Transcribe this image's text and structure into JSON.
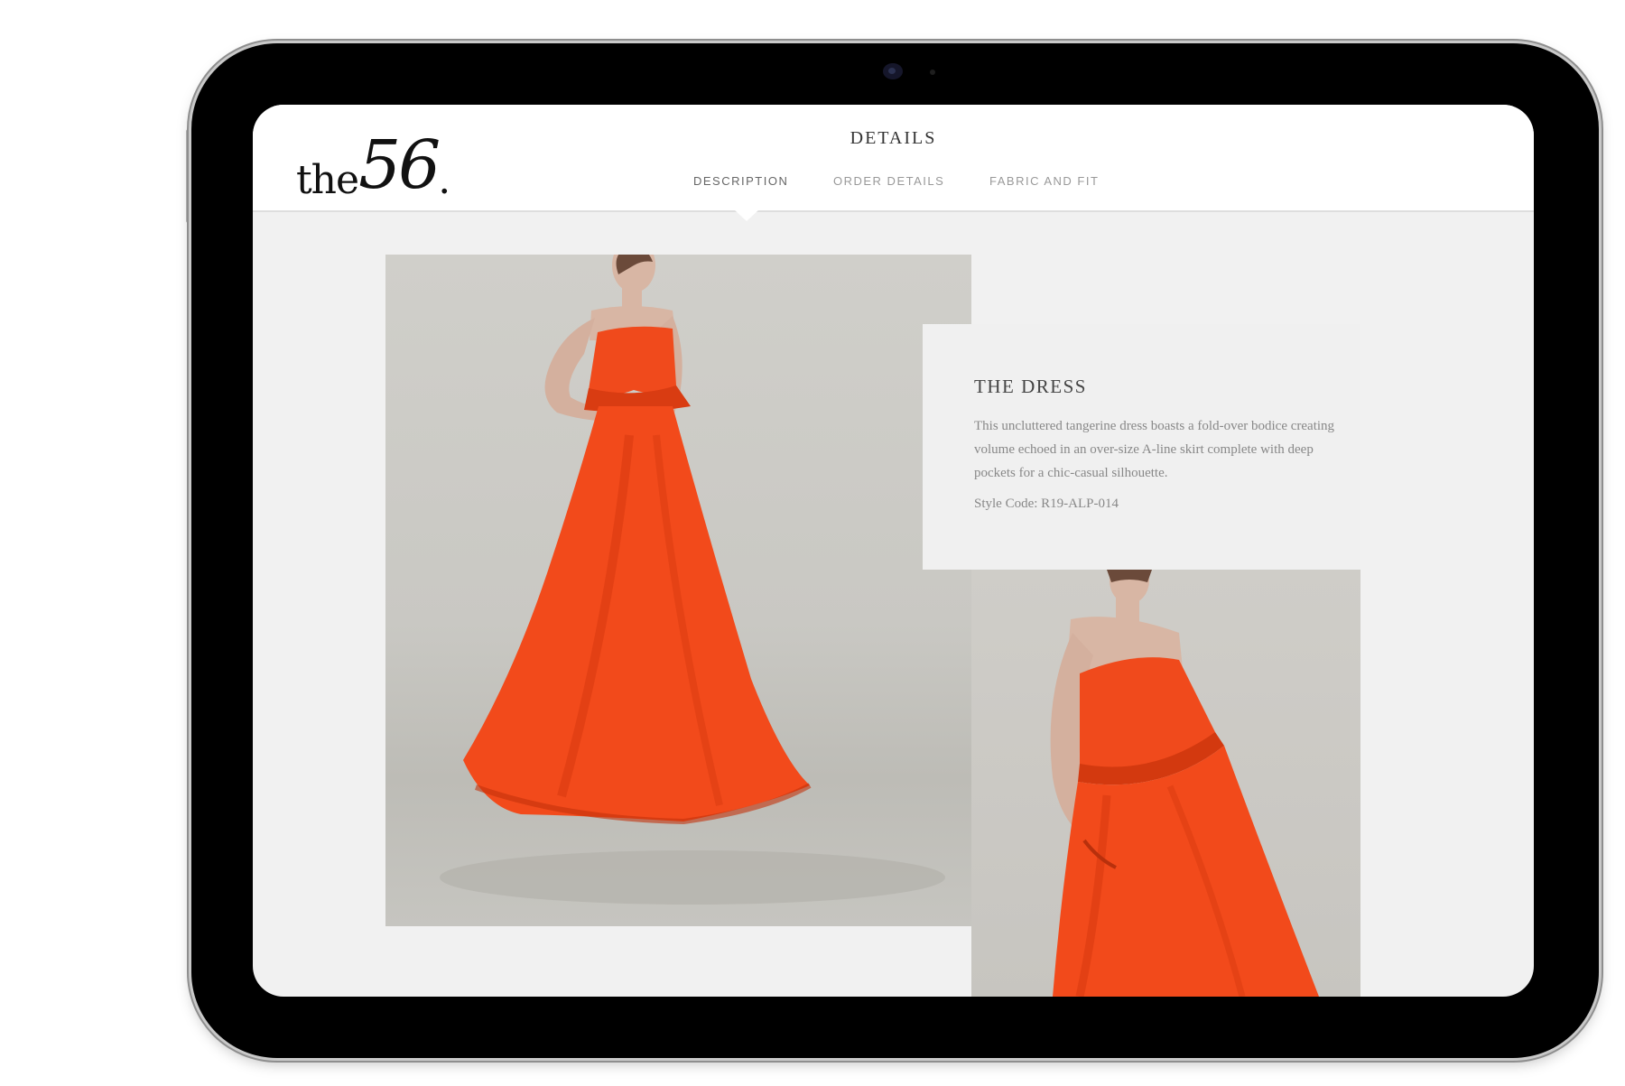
{
  "brand": {
    "logo_the": "the",
    "logo_number": "56",
    "logo_dot": "."
  },
  "header": {
    "title": "DETAILS",
    "tabs": [
      {
        "label": "DESCRIPTION",
        "active": true
      },
      {
        "label": "ORDER DETAILS",
        "active": false
      },
      {
        "label": "FABRIC AND FIT",
        "active": false
      }
    ]
  },
  "product": {
    "title": "THE DRESS",
    "description": "This uncluttered tangerine dress boasts a fold-over bodice creating volume echoed in an over-size A-line skirt complete with deep pockets for a chic-casual silhouette.",
    "style_code": "Style Code: R19-ALP-014"
  },
  "colors": {
    "dress": "#f2491b",
    "screen_bg": "#f1f1f1",
    "header_bg": "#ffffff"
  }
}
